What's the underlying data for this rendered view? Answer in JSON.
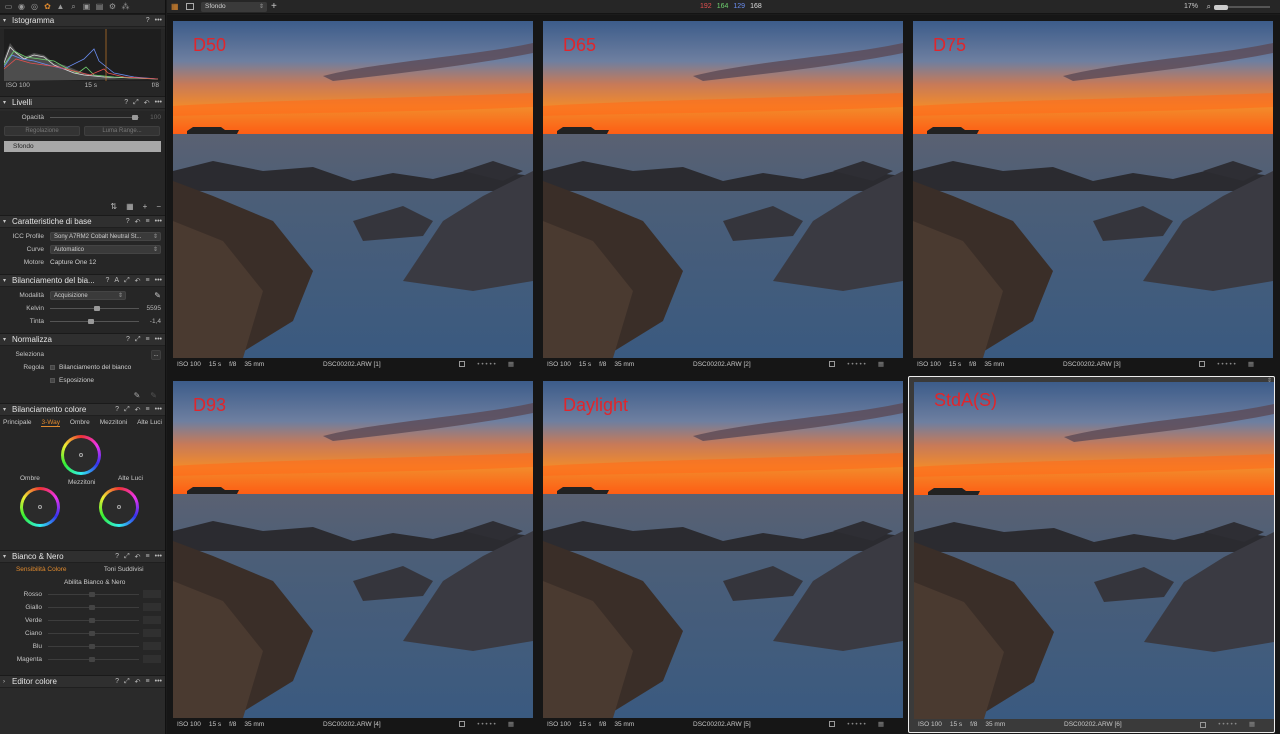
{
  "left_panel": {
    "histogram": {
      "title": "Istogramma",
      "iso": "ISO 100",
      "shutter": "15 s",
      "aperture": "f/8"
    },
    "layers": {
      "title": "Livelli",
      "opacity_label": "Opacità",
      "opacity_value": "100",
      "adjust_button": "Regolazione",
      "luma_button": "Luma Range...",
      "layer_name": "Sfondo"
    },
    "base": {
      "title": "Caratteristiche di base",
      "icc_label": "ICC Profile",
      "icc_value": "Sony A7RM2 Cobalt Neutral St...",
      "curve_label": "Curve",
      "curve_value": "Automatico",
      "engine_label": "Motore",
      "engine_value": "Capture One 12"
    },
    "wb": {
      "title": "Bilanciamento del bia...",
      "mode_label": "Modalità",
      "mode_value": "Acquisizione",
      "kelvin_label": "Kelvin",
      "kelvin_value": "5595",
      "kelvin_level": 0.55,
      "tint_label": "Tinta",
      "tint_value": "-1,4",
      "tint_level": 0.48
    },
    "normalize": {
      "title": "Normalizza",
      "select_label": "Seleziona",
      "select_button": "...",
      "adjust_label": "Regola",
      "opt1": "Bilanciamento del bianco",
      "opt2": "Esposizione"
    },
    "color_balance": {
      "title": "Bilanciamento colore",
      "tabs": [
        "Principale",
        "3-Way",
        "Ombre",
        "Mezzitoni",
        "Alte Luci"
      ],
      "active_tab": 1,
      "shadows": "Ombre",
      "midtones": "Mezzitoni",
      "highlights": "Alte Luci"
    },
    "bw": {
      "title": "Bianco & Nero",
      "tab1": "Sensibilità Colore",
      "tab2": "Toni Suddivisi",
      "enable": "Abilita Bianco & Nero",
      "colors": [
        "Rosso",
        "Giallo",
        "Verde",
        "Ciano",
        "Blu",
        "Magenta"
      ]
    },
    "color_editor": {
      "title": "Editor colore"
    }
  },
  "topbar": {
    "collection": "Sfondo",
    "rgb_r": "192",
    "rgb_g": "164",
    "rgb_b": "129",
    "rgb_l": "168",
    "zoom": "17%",
    "colors": {
      "r": "#e35050",
      "g": "#6fd06f",
      "b": "#6a8df0",
      "l": "#dddddd"
    }
  },
  "thumbs": [
    {
      "label": "D50",
      "iso": "ISO 100",
      "shutter": "15 s",
      "aperture": "f/8",
      "focal": "35 mm",
      "file": "DSC00202.ARW [1]",
      "selected": false
    },
    {
      "label": "D65",
      "iso": "ISO 100",
      "shutter": "15 s",
      "aperture": "f/8",
      "focal": "35 mm",
      "file": "DSC00202.ARW [2]",
      "selected": false
    },
    {
      "label": "D75",
      "iso": "ISO 100",
      "shutter": "15 s",
      "aperture": "f/8",
      "focal": "35 mm",
      "file": "DSC00202.ARW [3]",
      "selected": false
    },
    {
      "label": "D93",
      "iso": "ISO 100",
      "shutter": "15 s",
      "aperture": "f/8",
      "focal": "35 mm",
      "file": "DSC00202.ARW [4]",
      "selected": false
    },
    {
      "label": "Daylight",
      "iso": "ISO 100",
      "shutter": "15 s",
      "aperture": "f/8",
      "focal": "35 mm",
      "file": "DSC00202.ARW [5]",
      "selected": false
    },
    {
      "label": "StdA(S)",
      "iso": "ISO 100",
      "shutter": "15 s",
      "aperture": "f/8",
      "focal": "35 mm",
      "file": "DSC00202.ARW [6]",
      "selected": true
    }
  ]
}
